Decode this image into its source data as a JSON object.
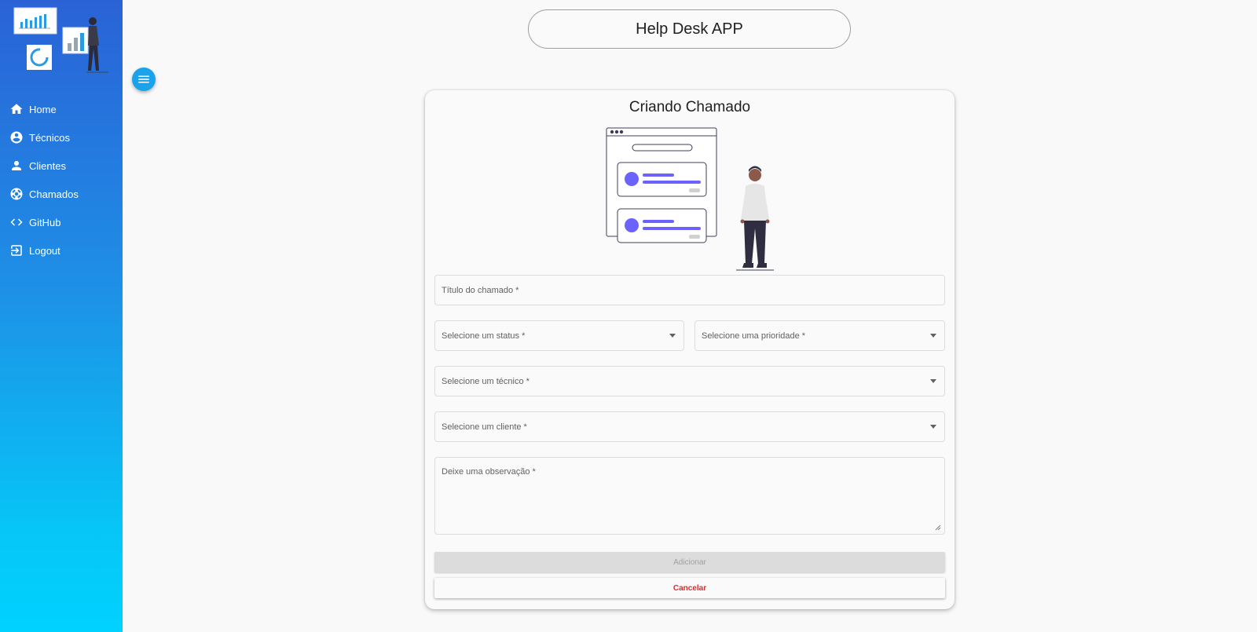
{
  "app": {
    "title": "Help Desk APP"
  },
  "sidebar": {
    "items": [
      {
        "label": "Home",
        "icon": "home-icon"
      },
      {
        "label": "Técnicos",
        "icon": "account-circle-icon"
      },
      {
        "label": "Clientes",
        "icon": "person-icon"
      },
      {
        "label": "Chamados",
        "icon": "support-icon"
      },
      {
        "label": "GitHub",
        "icon": "code-icon"
      },
      {
        "label": "Logout",
        "icon": "logout-icon"
      }
    ]
  },
  "form": {
    "title": "Criando Chamado",
    "titulo_label": "Título do chamado *",
    "status_label": "Selecione um status *",
    "prioridade_label": "Selecione uma prioridade *",
    "tecnico_label": "Selecione um técnico *",
    "cliente_label": "Selecione um cliente *",
    "observacao_label": "Deixe uma observação *",
    "add_label": "Adicionar",
    "cancel_label": "Cancelar"
  },
  "colors": {
    "accent": "#1aa3ea",
    "cancel": "#d32f2f",
    "illustration": "#6c63ff"
  }
}
